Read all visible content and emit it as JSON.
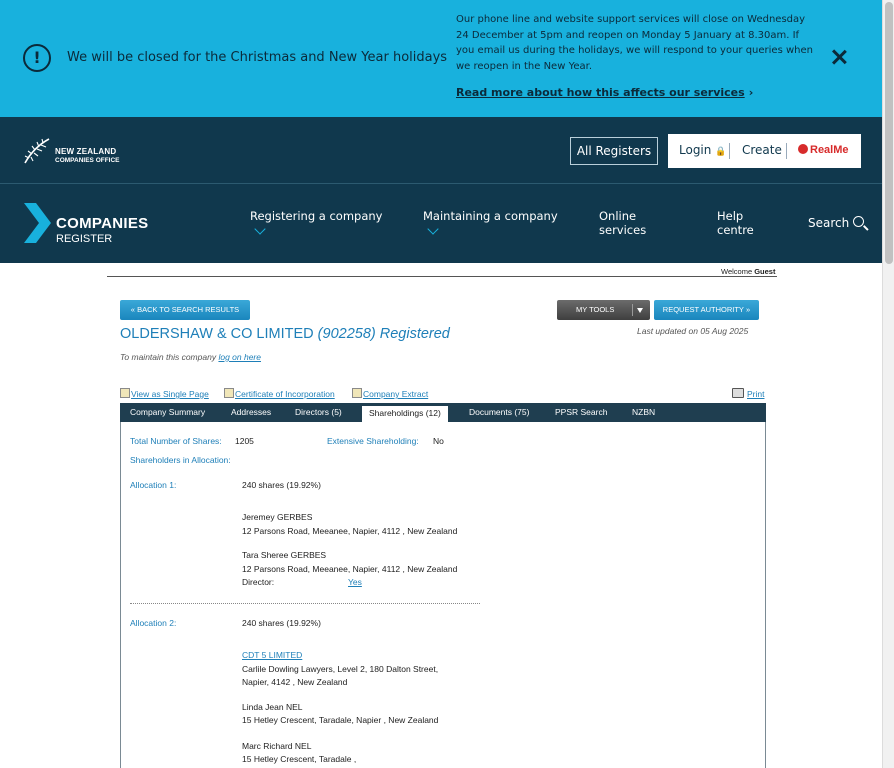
{
  "banner": {
    "icon": "alert-circle-icon",
    "headline": "We will be closed for the Christmas and New Year holidays",
    "notice": "Our phone line and website support services will close on Wednesday 24 December at 5pm and reopen on Monday 5 January at 8.30am. If you email us during the holidays, we will respond to your queries when we reopen in the New Year.",
    "read_more": "Read more about how this affects our services",
    "bg_color": "#18b1dd"
  },
  "header": {
    "logo_line1": "NEW ZEALAND",
    "logo_line2": "COMPANIES OFFICE",
    "all_registers": "All Registers",
    "login": "Login",
    "create": "Create",
    "realme": "RealMe",
    "bg_color": "#10384d"
  },
  "nav": {
    "logo_line1": "COMPANIES",
    "logo_line2": "REGISTER",
    "items": [
      {
        "label": "Registering a company"
      },
      {
        "label": "Maintaining a company"
      },
      {
        "label": "Online services"
      },
      {
        "label": "Help centre"
      }
    ],
    "search": "Search"
  },
  "session": {
    "welcome_prefix": "Welcome",
    "user": "Guest"
  },
  "toolbar": {
    "back": "BACK TO SEARCH RESULTS",
    "my_tools": "MY TOOLS",
    "request_authority": "REQUEST AUTHORITY"
  },
  "company": {
    "name": "OLDERSHAW & CO LIMITED",
    "number": "(902258)",
    "status": "Registered",
    "last_updated": "Last updated on 05 Aug 2025",
    "maintain_prefix": "To maintain this company",
    "maintain_link": "log on here"
  },
  "doc_links": {
    "single_page": "View as Single Page",
    "certificate": "Certificate of Incorporation",
    "extract": "Company Extract",
    "print": "Print"
  },
  "tabs": [
    {
      "label": "Company Summary"
    },
    {
      "label": "Addresses"
    },
    {
      "label": "Directors (5)"
    },
    {
      "label": "Shareholdings (12)"
    },
    {
      "label": "Documents (75)"
    },
    {
      "label": "PPSR Search"
    },
    {
      "label": "NZBN"
    }
  ],
  "shareholdings": {
    "total_label": "Total Number of Shares:",
    "total_value": "1205",
    "extensive_label": "Extensive Shareholding:",
    "extensive_value": "No",
    "in_allocation_label": "Shareholders in Allocation:",
    "allocations": [
      {
        "label": "Allocation 1:",
        "shares": "240 shares (19.92%)",
        "holders": [
          {
            "name": "Jeremey GERBES",
            "address": "12 Parsons Road, Meeanee, Napier, 4112 , New Zealand"
          },
          {
            "name": "Tara Sheree GERBES",
            "address": "12 Parsons Road, Meeanee, Napier, 4112 , New Zealand",
            "director_label": "Director:",
            "director_value": "Yes"
          }
        ]
      },
      {
        "label": "Allocation 2:",
        "shares": "240 shares (19.92%)",
        "holders": [
          {
            "name": "CDT 5 LIMITED",
            "address_line1": "Carlile Dowling Lawyers, Level 2, 180 Dalton Street,",
            "address_line2": "Napier, 4142 , New Zealand"
          },
          {
            "name": "Linda Jean NEL",
            "address": "15 Hetley Crescent, Taradale, Napier , New Zealand"
          },
          {
            "name": "Marc Richard NEL",
            "address": "15 Hetley Crescent, Taradale ,"
          }
        ]
      }
    ]
  }
}
